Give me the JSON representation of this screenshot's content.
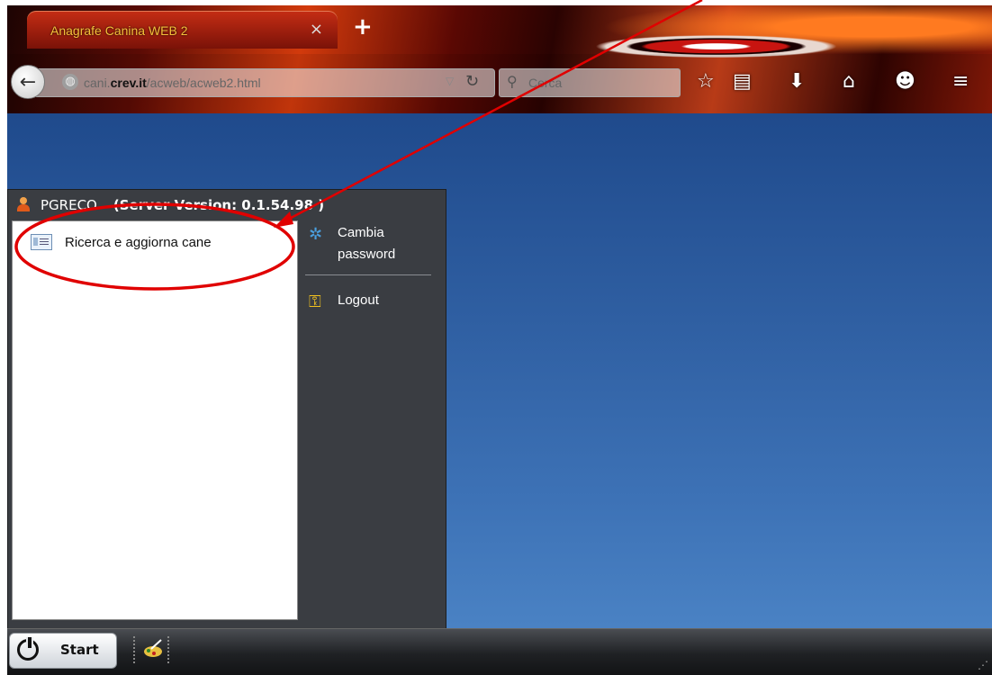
{
  "browser": {
    "tab_title": "Anagrafe Canina WEB 2",
    "tab_close": "×",
    "new_tab": "+",
    "url_host": "cani.",
    "url_domain": "crev.it",
    "url_path": "/acweb/acweb2.html",
    "search_placeholder": "Cerca",
    "icons": [
      "back-arrow-icon",
      "globe-icon",
      "reload-icon",
      "search-icon",
      "bookmark-star-icon",
      "reading-list-icon",
      "download-icon",
      "home-icon",
      "chat-icon",
      "menu-icon"
    ]
  },
  "window": {
    "user": "PGRECO",
    "server_version": "(Server Version: 0.1.54.98 )"
  },
  "menu": {
    "items": [
      {
        "label": "Ricerca e aggiorna cane",
        "icon": "list-window-icon"
      }
    ]
  },
  "side_menu": {
    "cambia_line1": "Cambia",
    "cambia_line2": "password",
    "logout": "Logout"
  },
  "taskbar": {
    "start_label": "Start"
  },
  "colors": {
    "desktop": "#2f5fa2",
    "panel": "#3a3d42",
    "annotation": "#e00000",
    "tab_title": "#f5c03a"
  }
}
